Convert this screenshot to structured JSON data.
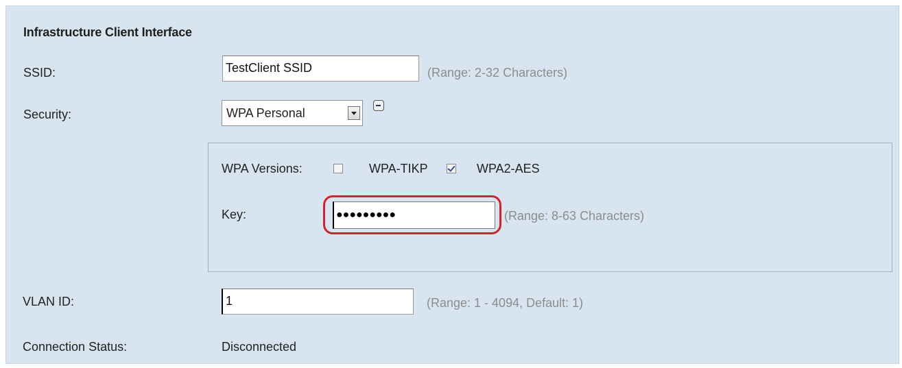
{
  "section": {
    "title": "Infrastructure Client Interface"
  },
  "ssid": {
    "label": "SSID:",
    "value": "TestClient SSID",
    "hint": "(Range: 2-32 Characters)"
  },
  "security": {
    "label": "Security:",
    "selected": "WPA Personal"
  },
  "wpa": {
    "versions_label": "WPA Versions:",
    "tikp": {
      "label": "WPA-TIKP",
      "checked": false
    },
    "aes": {
      "label": "WPA2-AES",
      "checked": true
    },
    "key_label": "Key:",
    "key_value": "●●●●●●●●●",
    "key_hint": "(Range: 8-63 Characters)"
  },
  "vlan": {
    "label": "VLAN ID:",
    "value": "1",
    "hint": "(Range: 1 - 4094, Default: 1)"
  },
  "connection": {
    "label": "Connection Status:",
    "value": "Disconnected"
  },
  "colors": {
    "panel_bg": "#d8e4ef",
    "highlight": "#d9202a",
    "hint_text": "#8c8c8c"
  },
  "icons": {
    "collapse": "minus-box-icon",
    "dropdown": "chevron-down-icon",
    "check": "check-icon"
  }
}
